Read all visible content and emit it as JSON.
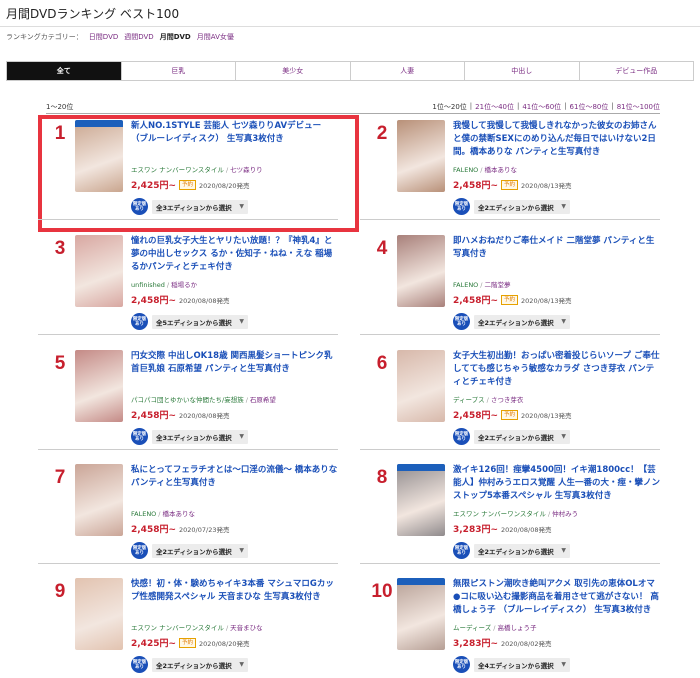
{
  "page_title": "月間DVDランキング ベスト100",
  "category_row": {
    "label": "ランキングカテゴリー：",
    "links": [
      "日間DVD",
      "週間DVD",
      "月間DVD",
      "月間AV女優"
    ],
    "current_index": 2
  },
  "tabs": [
    "全て",
    "巨乳",
    "美少女",
    "人妻",
    "中出し",
    "デビュー作品"
  ],
  "range_label": "1〜20位",
  "pager": [
    "1位〜20位",
    "21位〜40位",
    "41位〜60位",
    "61位〜80位",
    "81位〜100位"
  ],
  "edition_badge": "限定版あり",
  "release_suffix": "発売",
  "colors": {
    "rank": "#c71f2d",
    "title": "#1a4fb8",
    "price": "#c71f2d",
    "highlight": "#e8343f",
    "active_tab": "#111111"
  },
  "items": [
    {
      "rank": "1",
      "title": "新人NO.1STYLE 芸能人 七ツ森りりAVデビュー （ブルーレイディスク） 生写真3枚付き",
      "maker": "エスワン ナンバーワンスタイル",
      "actress": "七ツ森りり",
      "price": "2,425円~",
      "reserve": "予約",
      "date": "2020/08/20",
      "editions": "全3エディションから選択",
      "thumb_color": "#c9a58e",
      "bluray": true
    },
    {
      "rank": "2",
      "title": "我慢して我慢して我慢しきれなかった彼女のお姉さんと僕の禁断SEXにのめり込んだ毎日ではいけない2日間。橋本ありな パンティと生写真付き",
      "maker": "FALENO",
      "actress": "橋本ありな",
      "price": "2,458円~",
      "reserve": "予約",
      "date": "2020/08/13",
      "editions": "全2エディションから選択",
      "thumb_color": "#b89078",
      "bluray": false
    },
    {
      "rank": "3",
      "title": "憧れの巨乳女子大生とヤリたい放題！？『神乳4』と夢の中出しセックス るか・佐知子・ねね・えな 稲場るかパンティとチェキ付き",
      "maker": "unfinished",
      "actress": "稲場るか",
      "price": "2,458円~",
      "reserve": "",
      "date": "2020/08/08",
      "editions": "全5エディションから選択",
      "thumb_color": "#d8a7a1",
      "bluray": false
    },
    {
      "rank": "4",
      "title": "即ハメおねだりご奉仕メイド 二階堂夢 パンティと生写真付き",
      "maker": "FALENO",
      "actress": "二階堂夢",
      "price": "2,458円~",
      "reserve": "予約",
      "date": "2020/08/13",
      "editions": "全2エディションから選択",
      "thumb_color": "#a8807a",
      "bluray": false
    },
    {
      "rank": "5",
      "title": "円女交際 中出しOK18歳 関西黒髪ショートピンク乳首巨乳娘 石原希望 パンティと生写真付き",
      "maker": "パコパコ団とゆかいな仲間たち/妄想族",
      "actress": "石原希望",
      "price": "2,458円~",
      "reserve": "",
      "date": "2020/08/08",
      "editions": "全3エディションから選択",
      "thumb_color": "#c48a86",
      "bluray": false
    },
    {
      "rank": "6",
      "title": "女子大生初出勤！おっぱい密着投じらいソープ ご奉仕してても感じちゃう敏感なカラダ さつき芽衣 パンティとチェキ付き",
      "maker": "ディープス",
      "actress": "さつき芽衣",
      "price": "2,458円~",
      "reserve": "予約",
      "date": "2020/08/13",
      "editions": "全2エディションから選択",
      "thumb_color": "#d7b8aa",
      "bluray": false
    },
    {
      "rank": "7",
      "title": "私にとってフェラチオとは〜口淫の流儀〜 橋本ありな パンティと生写真付き",
      "maker": "FALENO",
      "actress": "橋本ありな",
      "price": "2,458円~",
      "reserve": "",
      "date": "2020/07/23",
      "editions": "全2エディションから選択",
      "thumb_color": "#caa597",
      "bluray": false
    },
    {
      "rank": "8",
      "title": "激イキ126回！痙攣4500回！イキ潮1800cc！【芸能人】仲村みうエロス覚醒 人生一番の大・痙・攣ノンストップ5本番スペシャル 生写真3枚付き",
      "maker": "エスワン ナンバーワンスタイル",
      "actress": "仲村みう",
      "price": "3,283円~",
      "reserve": "",
      "date": "2020/08/08",
      "editions": "全2エディションから選択",
      "thumb_color": "#8f8a8c",
      "bluray": true
    },
    {
      "rank": "9",
      "title": "快感！初・体・験めちゃイキ3本番 マシュマロGカップ性感開発スペシャル 天音まひな 生写真3枚付き",
      "maker": "エスワン ナンバーワンスタイル",
      "actress": "天音まひな",
      "price": "2,425円~",
      "reserve": "予約",
      "date": "2020/08/20",
      "editions": "全2エディションから選択",
      "thumb_color": "#e2c3b0",
      "bluray": false
    },
    {
      "rank": "10",
      "title": "無限ピストン潮吹き絶叫アクメ 取引先の恵体OLオマ●コに吸い込む撮影商品を着用させて逃がさない！ 高橋しょう子 （ブルーレイディスク） 生写真3枚付き",
      "maker": "ムーディーズ",
      "actress": "高橋しょう子",
      "price": "3,283円~",
      "reserve": "",
      "date": "2020/08/02",
      "editions": "全4エディションから選択",
      "thumb_color": "#b59e94",
      "bluray": true
    }
  ]
}
